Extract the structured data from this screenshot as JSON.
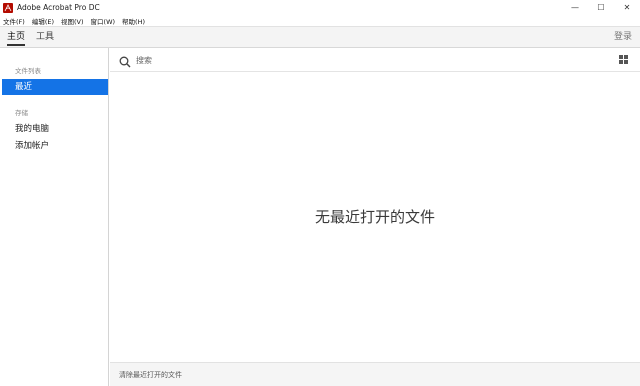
{
  "window": {
    "title": "Adobe Acrobat Pro DC",
    "minimize": "—",
    "maximize": "☐",
    "close": "✕"
  },
  "menubar": {
    "items": [
      "文件(F)",
      "编辑(E)",
      "视图(V)",
      "窗口(W)",
      "帮助(H)"
    ]
  },
  "tabs": {
    "home": "主页",
    "tools": "工具",
    "login": "登录"
  },
  "sidebar": {
    "file_list_heading": "文件列表",
    "recent": "最近",
    "storage_heading": "存储",
    "my_computer": "我的电脑",
    "add_account": "添加帐户"
  },
  "main": {
    "search_placeholder": "搜索",
    "empty_message": "无最近打开的文件",
    "clear_recent": "清除最近打开的文件"
  },
  "colors": {
    "accent": "#1473e6",
    "brand": "#b30b00"
  }
}
